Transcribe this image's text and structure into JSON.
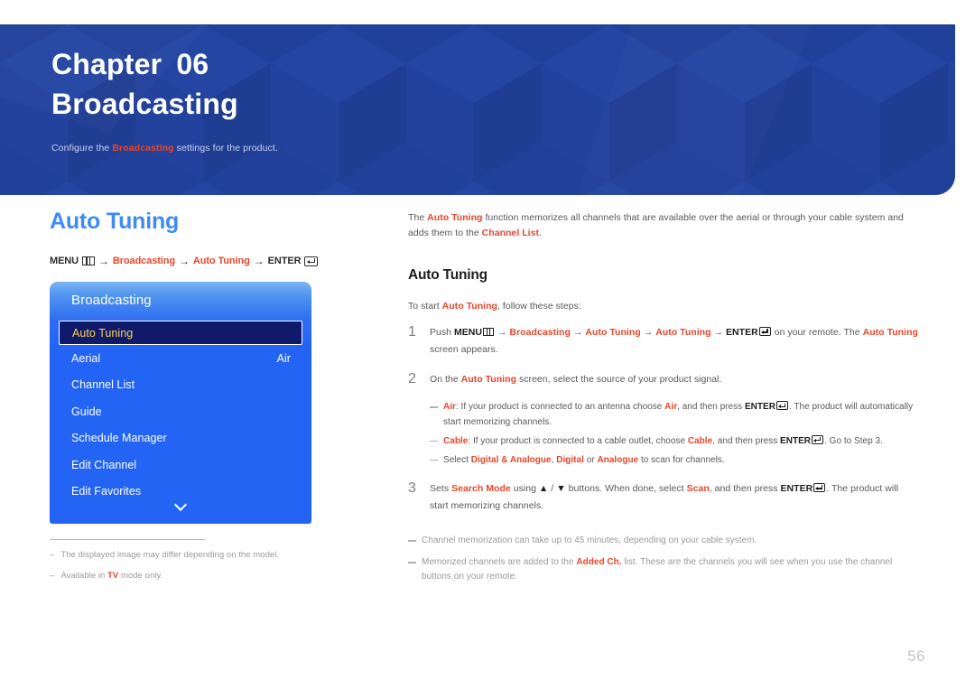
{
  "banner": {
    "chapter_word": "Chapter",
    "chapter_number": "06",
    "chapter_name": "Broadcasting",
    "subtitle_pre": "Configure the ",
    "subtitle_hl": "Broadcasting",
    "subtitle_post": " settings for the product.",
    "bg_color": "#21409a",
    "accent_color": "#e8452a"
  },
  "left": {
    "section_title": "Auto Tuning",
    "section_title_color": "#3d8bf5",
    "breadcrumb": {
      "menu_label": "MENU",
      "menu_icon": "menu-grid-icon",
      "arrow": "→",
      "item1": "Broadcasting",
      "item2": "Auto Tuning",
      "enter_label": "ENTER",
      "enter_icon": "enter-return-icon"
    },
    "osd": {
      "header": "Broadcasting",
      "scroll_icon": "chevron-down-icon",
      "selected_bg": "#101a6b",
      "selected_text_color": "#ffd24a",
      "panel_color": "#2464f5",
      "items": [
        {
          "label": "Auto Tuning",
          "value": "",
          "selected": true
        },
        {
          "label": "Aerial",
          "value": "Air",
          "selected": false
        },
        {
          "label": "Channel List",
          "value": "",
          "selected": false
        },
        {
          "label": "Guide",
          "value": "",
          "selected": false
        },
        {
          "label": "Schedule Manager",
          "value": "",
          "selected": false
        },
        {
          "label": "Edit Channel",
          "value": "",
          "selected": false
        },
        {
          "label": "Edit Favorites",
          "value": "",
          "selected": false
        }
      ]
    },
    "notes": [
      {
        "dash": "–",
        "text": "The displayed image may differ depending on the model."
      },
      {
        "dash": "–",
        "pre": "Available in ",
        "hl": "TV",
        "post": " mode only."
      }
    ]
  },
  "right": {
    "intro": {
      "p1": "The ",
      "hl1": "Auto Tuning",
      "p2": " function memorizes all channels that are available over the aerial or through your cable system and adds them to the ",
      "hl2": "Channel List",
      "p3": "."
    },
    "sub_title": "Auto Tuning",
    "lead": {
      "pre": "To start ",
      "hl": "Auto Tuning",
      "post": ", follow these steps:"
    },
    "steps": [
      {
        "num": "1",
        "parts": {
          "a": "Push ",
          "menu": "MENU",
          "arrow": "→",
          "b1": "Broadcasting",
          "b2": "Auto Tuning",
          "b3": "Auto Tuning",
          "enter": "ENTER",
          "c": " on your remote. The ",
          "hl": "Auto Tuning",
          "d": " screen appears."
        }
      },
      {
        "num": "2",
        "parts": {
          "a": "On the ",
          "hl": "Auto Tuning",
          "b": " screen, select the source of your product signal."
        }
      },
      {
        "num": "3",
        "parts": {
          "a": "Sets ",
          "hl1": "Search Mode",
          "b": " using ",
          "up": "▲",
          "slash": " / ",
          "down": "▼",
          "c": " buttons. When done, select ",
          "hl2": "Scan",
          "d": ", and then press ",
          "enter": "ENTER",
          "e": ". The product will start memorizing channels."
        }
      }
    ],
    "bullets": [
      {
        "hl1": "Air",
        "t1": ": If your product is connected to an antenna choose ",
        "hl2": "Air",
        "t2": ", and then press ",
        "enter": "ENTER",
        "t3": ". The product will automatically start memorizing channels."
      },
      {
        "hl1": "Cable",
        "t1": ": If your product is connected to a cable outlet, choose ",
        "hl2": "Cable",
        "t2": ", and then press ",
        "enter": "ENTER",
        "t3": ". Go to Step 3."
      },
      {
        "t0": "Select ",
        "hl1": "Digital & Analogue",
        "t1": ", ",
        "hl2": "Digital",
        "t2": " or ",
        "hl3": "Analogue",
        "t3": " to scan for channels."
      }
    ],
    "end_notes": [
      {
        "text": "Channel memorization can take up to 45 minutes, depending on your cable system."
      },
      {
        "pre": "Memorized channels are added to the ",
        "hl": "Added Ch.",
        "post": " list. These are the channels you will see when you use the channel buttons on your remote."
      }
    ]
  },
  "page_number": "56"
}
